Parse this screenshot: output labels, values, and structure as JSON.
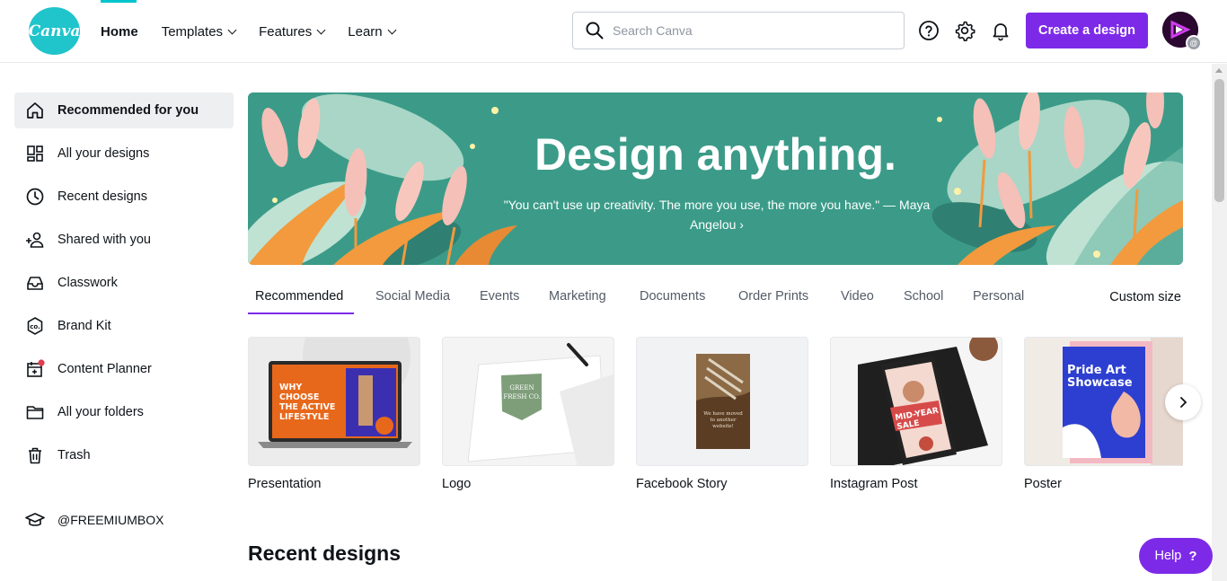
{
  "header": {
    "logo_text": "Canva",
    "nav": [
      {
        "label": "Home",
        "active": true,
        "dropdown": false
      },
      {
        "label": "Templates",
        "active": false,
        "dropdown": true
      },
      {
        "label": "Features",
        "active": false,
        "dropdown": true
      },
      {
        "label": "Learn",
        "active": false,
        "dropdown": true
      }
    ],
    "search_placeholder": "Search Canva",
    "icons": [
      "help-circle-icon",
      "gear-icon",
      "bell-icon"
    ],
    "create_button": "Create a design",
    "avatar_badge": "@"
  },
  "sidebar": {
    "items": [
      {
        "label": "Recommended for you",
        "icon": "home-icon",
        "active": true
      },
      {
        "label": "All your designs",
        "icon": "grid-icon"
      },
      {
        "label": "Recent designs",
        "icon": "clock-icon"
      },
      {
        "label": "Shared with you",
        "icon": "people-icon"
      },
      {
        "label": "Classwork",
        "icon": "inbox-icon"
      },
      {
        "label": "Brand Kit",
        "icon": "brand-kit-icon"
      },
      {
        "label": "Content Planner",
        "icon": "calendar-icon"
      },
      {
        "label": "All your folders",
        "icon": "folder-icon"
      },
      {
        "label": "Trash",
        "icon": "trash-icon"
      }
    ],
    "team": {
      "label": "@FREEMIUMBOX",
      "icon": "graduation-cap-icon"
    }
  },
  "hero": {
    "title": "Design anything.",
    "quote": "\"You can't use up creativity. The more you use, the more you have.\" — Maya Angelou ›"
  },
  "tabs": [
    "Recommended",
    "Social Media",
    "Events",
    "Marketing",
    "Documents",
    "Order Prints",
    "Video",
    "School",
    "Personal"
  ],
  "custom_size": "Custom size",
  "cards": [
    {
      "label": "Presentation",
      "thumb_text": "WHY CHOOSE THE ACTIVE LIFESTYLE"
    },
    {
      "label": "Logo",
      "thumb_text": "GREEN FRESH CO."
    },
    {
      "label": "Facebook Story",
      "thumb_text": "We have moved to another website!"
    },
    {
      "label": "Instagram Post",
      "thumb_text": "MID-YEAR SALE"
    },
    {
      "label": "Poster",
      "thumb_text": "Pride Art Showcase"
    }
  ],
  "section_title": "Recent designs",
  "help": {
    "label": "Help",
    "symbol": "?"
  },
  "colors": {
    "accent": "#7d2ae8",
    "brand": "#20c4cb",
    "hero_bg": "#3a9c8a"
  }
}
